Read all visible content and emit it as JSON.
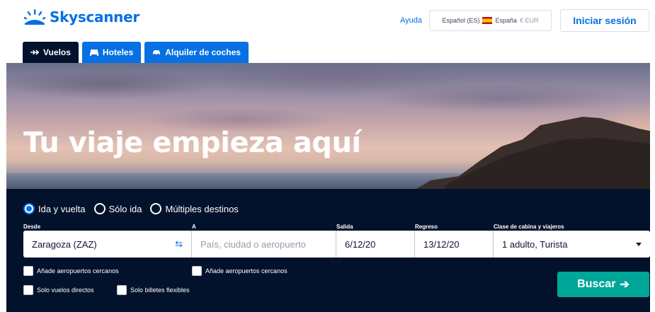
{
  "header": {
    "logo_text": "Skyscanner",
    "help_label": "Ayuda",
    "locale": {
      "language": "Español (ES)",
      "country": "España",
      "currency": "€ EUR",
      "flag": "spain-flag"
    },
    "login_label": "Iniciar sesión"
  },
  "tabs": [
    {
      "label": "Vuelos",
      "icon": "plane-icon",
      "active": true
    },
    {
      "label": "Hoteles",
      "icon": "bed-icon",
      "active": false
    },
    {
      "label": "Alquiler de coches",
      "icon": "car-icon",
      "active": false
    }
  ],
  "hero": {
    "title": "Tu viaje empieza aquí"
  },
  "search": {
    "trip_types": [
      {
        "label": "Ida y vuelta",
        "selected": true
      },
      {
        "label": "Sólo ida",
        "selected": false
      },
      {
        "label": "Múltiples destinos",
        "selected": false
      }
    ],
    "labels": {
      "from": "Desde",
      "to": "A",
      "depart": "Salida",
      "return": "Regreso",
      "cabin": "Clase de cabina y viajeros"
    },
    "from_value": "Zaragoza (ZAZ)",
    "to_placeholder": "País, ciudad o aeropuerto",
    "depart_value": "6/12/20",
    "return_value": "13/12/20",
    "cabin_value": "1 adulto, Turista",
    "checkboxes": {
      "nearby_from": "Añade aeropuertos cercanos",
      "nearby_to": "Añade aeropuertos cercanos",
      "direct": "Solo vuelos directos",
      "flexible": "Solo billetes flexibles"
    },
    "search_button": "Buscar"
  },
  "colors": {
    "brand_blue": "#0770e3",
    "dark_navy": "#02122c",
    "search_green": "#00a698"
  }
}
